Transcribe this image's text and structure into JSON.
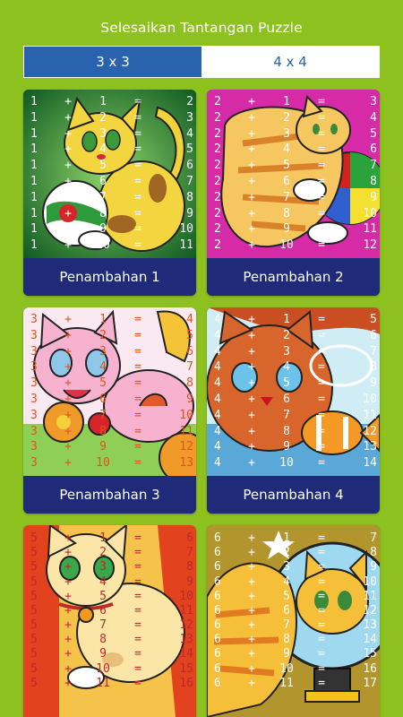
{
  "header": {
    "title": "Selesaikan Tantangan Puzzle"
  },
  "tabs": [
    {
      "label": "3 x 3",
      "active": true
    },
    {
      "label": "4 x 4",
      "active": false
    }
  ],
  "cards": [
    {
      "label": "Penambahan 1",
      "addend": 1,
      "first": [
        1,
        1,
        1,
        1,
        1,
        1,
        1,
        1,
        1,
        1
      ],
      "second": [
        1,
        2,
        3,
        4,
        5,
        6,
        7,
        8,
        9,
        10
      ],
      "result": [
        2,
        3,
        4,
        5,
        6,
        7,
        8,
        9,
        10,
        11
      ],
      "text_color": "#ffffff",
      "bg": "#1f7a2e"
    },
    {
      "label": "Penambahan 2",
      "addend": 2,
      "first": [
        2,
        2,
        2,
        2,
        2,
        2,
        2,
        2,
        2,
        2
      ],
      "second": [
        1,
        2,
        3,
        4,
        5,
        6,
        7,
        8,
        9,
        10
      ],
      "result": [
        3,
        4,
        5,
        6,
        7,
        8,
        9,
        10,
        11,
        12
      ],
      "text_color": "#ffffff",
      "bg": "#d62aa6"
    },
    {
      "label": "Penambahan 3",
      "addend": 3,
      "first": [
        3,
        3,
        3,
        3,
        3,
        3,
        3,
        3,
        3,
        3
      ],
      "second": [
        1,
        2,
        3,
        4,
        5,
        6,
        7,
        8,
        9,
        10
      ],
      "result": [
        4,
        5,
        6,
        7,
        8,
        9,
        10,
        11,
        12,
        13
      ],
      "text_color": "#e0541b",
      "bg": "#f5a9c9"
    },
    {
      "label": "Penambahan 4",
      "addend": 4,
      "first": [
        4,
        4,
        4,
        4,
        4,
        4,
        4,
        4,
        4,
        4
      ],
      "second": [
        1,
        2,
        3,
        4,
        5,
        6,
        7,
        8,
        9,
        10
      ],
      "result": [
        5,
        6,
        7,
        8,
        9,
        10,
        11,
        12,
        13,
        14
      ],
      "text_color": "#ffffff",
      "bg": "#d8572a"
    },
    {
      "label": "Penambahan 5",
      "addend": 5,
      "first": [
        5,
        5,
        5,
        5,
        5,
        5,
        5,
        5,
        5,
        5,
        5
      ],
      "second": [
        1,
        2,
        3,
        4,
        5,
        6,
        7,
        8,
        9,
        10,
        11
      ],
      "result": [
        6,
        7,
        8,
        9,
        10,
        11,
        12,
        13,
        14,
        15,
        16
      ],
      "text_color": "#c0282a",
      "bg": "#f6c34a"
    },
    {
      "label": "Penambahan 6",
      "addend": 6,
      "first": [
        6,
        6,
        6,
        6,
        6,
        6,
        6,
        6,
        6,
        6,
        6
      ],
      "second": [
        1,
        2,
        3,
        4,
        5,
        6,
        7,
        8,
        9,
        10,
        11
      ],
      "result": [
        7,
        8,
        9,
        10,
        11,
        12,
        13,
        14,
        15,
        16,
        17
      ],
      "text_color": "#ffffff",
      "bg": "#a8842e"
    }
  ],
  "symbols": {
    "plus": "+",
    "equals": "="
  }
}
